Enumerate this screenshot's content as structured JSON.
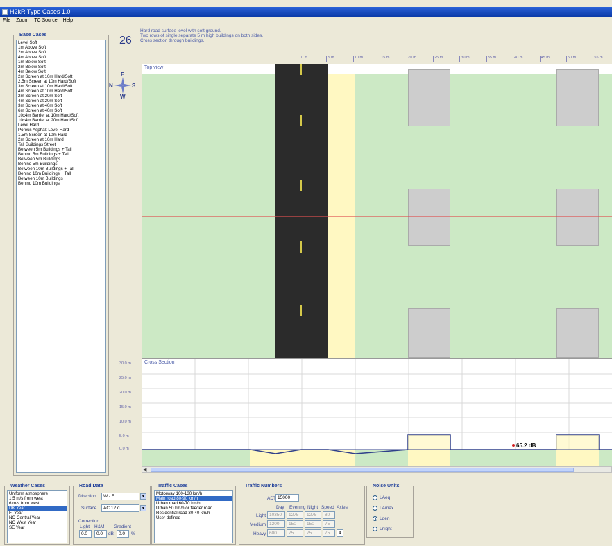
{
  "window": {
    "title": "H2kR Type Cases 1.0"
  },
  "menu": [
    "File",
    "Zoom",
    "TC Source",
    "Help"
  ],
  "base_cases": {
    "title": "Base Cases",
    "selected_index": 31,
    "items": [
      "Level Soft",
      "1m Above Soft",
      "2m Above Soft",
      "4m Above Soft",
      "1m Below Soft",
      "2m Below Soft",
      "4m Below Soft",
      "2m Screen at 10m Hard/Soft",
      "2.5m Screen at 10m Hard/Soft",
      "3m Screen at 10m Hard/Soft",
      "4m Screen at 10m Hard/Soft",
      "2m Screen at 20m Soft",
      "4m Screen at 20m Soft",
      "3m Screen at 40m Soft",
      "6m Screen at 40m Soft",
      "10x4m Barrier at 10m Hard/Soft",
      "10x4m Barrier at 20m Hard/Soft",
      "Level Hard",
      "Porous Asphalt Level Hard",
      "1.5m Screen at 10m Hard",
      "2m Screen at 10m Hard",
      "Tall Buildings Street",
      "Between 5m Buildings + Tall",
      "Behind 5m Buildings + Tall",
      "Between 5m Buildings",
      "Behind 5m Buildings",
      "Between 10m Buildings + Tall",
      "Behind 10m Buildings + Tall",
      "Between 10m Buildings",
      "Behind 10m Buildings"
    ]
  },
  "case": {
    "number": "26",
    "description_line1": "Hard road surface level with soft ground.",
    "description_line2": "Two rows of single separate 5 m high buildings on both sides.",
    "description_line3": "Cross section through buildings."
  },
  "compass": {
    "n": "N",
    "e": "E",
    "s": "S",
    "w": "W"
  },
  "ruler": [
    "0 m",
    "5 m",
    "10 m",
    "15 m",
    "20 m",
    "25 m",
    "30 m",
    "35 m",
    "40 m",
    "45 m",
    "50 m",
    "55 m"
  ],
  "topview": {
    "label": "Top view"
  },
  "cross_section": {
    "label": "Cross Section",
    "y_ticks": [
      "30.0 m",
      "25.0 m",
      "20.0 m",
      "15.0 m",
      "10.0 m",
      "5.0 m",
      "0.0 m"
    ],
    "receiver_level": "65.2 dB"
  },
  "weather": {
    "title": "Weather Cases",
    "selected_index": 3,
    "items": [
      "Uniform atmosphere",
      "1.5 m/s from west",
      "6 m/s from west",
      "DK Year",
      "FI Year",
      "NO Central Year",
      "NO West Year",
      "SE Year"
    ]
  },
  "road_data": {
    "title": "Road Data",
    "direction_label": "Direction",
    "direction_value": "W - E",
    "surface_label": "Surface",
    "surface_value": "AC 12 d",
    "correction_label": "Correction",
    "col_light": "Light",
    "col_heavy": "H&M",
    "col_gradient": "Gradient",
    "light_value": "0.0",
    "heavy_value": "0.0",
    "db_unit": "dB",
    "gradient_value": "0.0",
    "pct_unit": "%"
  },
  "traffic_cases": {
    "title": "Traffic Cases",
    "selected_index": 1,
    "items": [
      "Motorway 100-130 km/h",
      "Main road 80-90 km/h",
      "Urban road 60-70 km/h",
      "Urban 50 km/h or feeder road",
      "Residential road 30-40 km/h",
      "User defined"
    ]
  },
  "traffic_numbers": {
    "title": "Traffic Numbers",
    "adt_label": "ADT",
    "adt_value": "15000",
    "headers": [
      "Day",
      "Evening",
      "Night",
      "Speed",
      "Axles"
    ],
    "rows": [
      {
        "label": "Light",
        "values": [
          "10350",
          "1275",
          "1275",
          "80"
        ]
      },
      {
        "label": "Medium",
        "values": [
          "1200",
          "150",
          "150",
          "75"
        ]
      },
      {
        "label": "Heavy",
        "values": [
          "600",
          "75",
          "75",
          "75",
          "4"
        ]
      }
    ]
  },
  "noise_units": {
    "title": "Noise Units",
    "selected_index": 2,
    "items": [
      "LAeq",
      "LAmax",
      "Lden",
      "Lnight"
    ]
  }
}
